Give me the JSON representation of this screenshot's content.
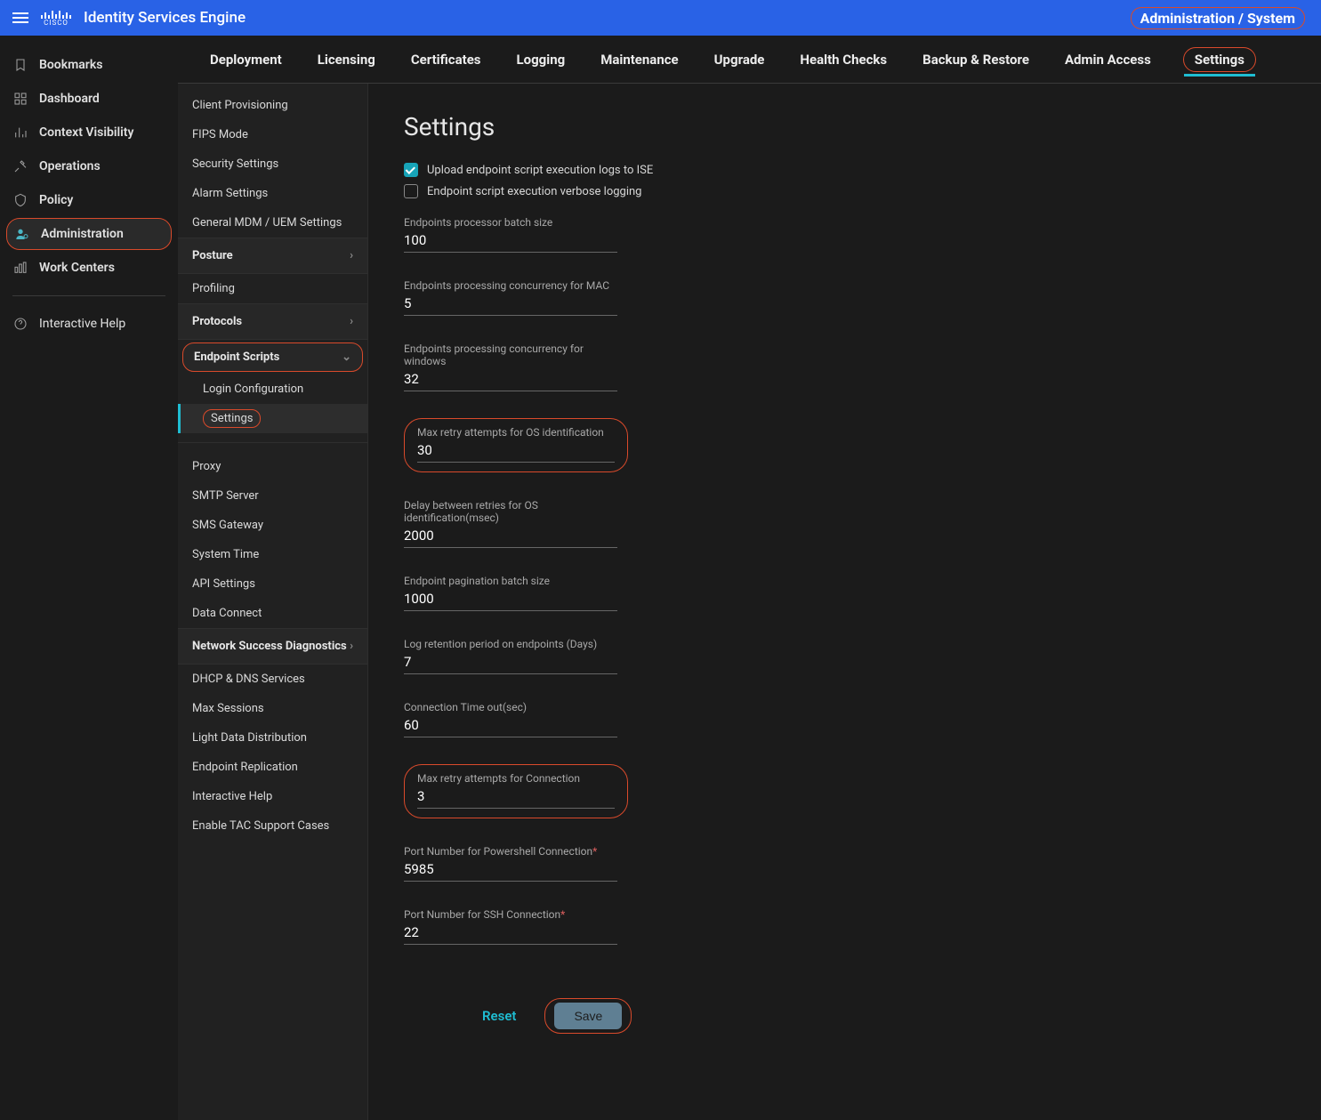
{
  "topbar": {
    "app_title": "Identity Services Engine",
    "breadcrumb": "Administration / System",
    "cisco_word": "CISCO"
  },
  "left_nav": {
    "items": [
      {
        "label": "Bookmarks",
        "icon": "bookmark"
      },
      {
        "label": "Dashboard",
        "icon": "dashboard"
      },
      {
        "label": "Context Visibility",
        "icon": "context"
      },
      {
        "label": "Operations",
        "icon": "ops"
      },
      {
        "label": "Policy",
        "icon": "policy"
      },
      {
        "label": "Administration",
        "icon": "admin",
        "active": true,
        "highlight": true
      },
      {
        "label": "Work Centers",
        "icon": "workcenters"
      }
    ],
    "help_label": "Interactive Help"
  },
  "tabs": [
    {
      "label": "Deployment"
    },
    {
      "label": "Licensing"
    },
    {
      "label": "Certificates"
    },
    {
      "label": "Logging"
    },
    {
      "label": "Maintenance"
    },
    {
      "label": "Upgrade"
    },
    {
      "label": "Health Checks"
    },
    {
      "label": "Backup & Restore"
    },
    {
      "label": "Admin Access"
    },
    {
      "label": "Settings",
      "active": true,
      "highlight": true
    }
  ],
  "settings_panel": {
    "links_top": [
      "Client Provisioning",
      "FIPS Mode",
      "Security Settings",
      "Alarm Settings",
      "General MDM / UEM Settings"
    ],
    "posture_label": "Posture",
    "profiling_label": "Profiling",
    "protocols_label": "Protocols",
    "endpoint_scripts_label": "Endpoint Scripts",
    "endpoint_scripts_sub": [
      {
        "label": "Login Configuration"
      },
      {
        "label": "Settings",
        "active": true,
        "highlight": true
      }
    ],
    "links_mid": [
      "Proxy",
      "SMTP Server",
      "SMS Gateway",
      "System Time",
      "API Settings",
      "Data Connect"
    ],
    "network_diag_label": "Network Success Diagnostics",
    "links_bottom": [
      "DHCP & DNS Services",
      "Max Sessions",
      "Light Data Distribution",
      "Endpoint Replication",
      "Interactive Help",
      "Enable TAC Support Cases"
    ]
  },
  "page": {
    "title": "Settings",
    "check_upload_label": "Upload endpoint script execution logs to ISE",
    "check_verbose_label": "Endpoint script execution verbose logging",
    "fields": [
      {
        "key": "batch_size",
        "label": "Endpoints processor batch size",
        "value": "100"
      },
      {
        "key": "conc_mac",
        "label": "Endpoints processing concurrency for MAC",
        "value": "5"
      },
      {
        "key": "conc_win",
        "label": "Endpoints processing concurrency for windows",
        "value": "32"
      },
      {
        "key": "max_retry_os",
        "label": "Max retry attempts for OS identification",
        "value": "30",
        "highlight": true
      },
      {
        "key": "delay_retries",
        "label": "Delay between retries for OS identification(msec)",
        "value": "2000"
      },
      {
        "key": "pagination_batch",
        "label": "Endpoint pagination batch size",
        "value": "1000"
      },
      {
        "key": "log_retention",
        "label": "Log retention period on endpoints (Days)",
        "value": "7"
      },
      {
        "key": "conn_timeout",
        "label": "Connection Time out(sec)",
        "value": "60"
      },
      {
        "key": "max_retry_conn",
        "label": "Max retry attempts for Connection",
        "value": "3",
        "highlight": true
      },
      {
        "key": "port_ps",
        "label": "Port Number for Powershell Connection",
        "value": "5985",
        "required": true
      },
      {
        "key": "port_ssh",
        "label": "Port Number for SSH Connection",
        "value": "22",
        "required": true
      }
    ],
    "reset_label": "Reset",
    "save_label": "Save"
  }
}
